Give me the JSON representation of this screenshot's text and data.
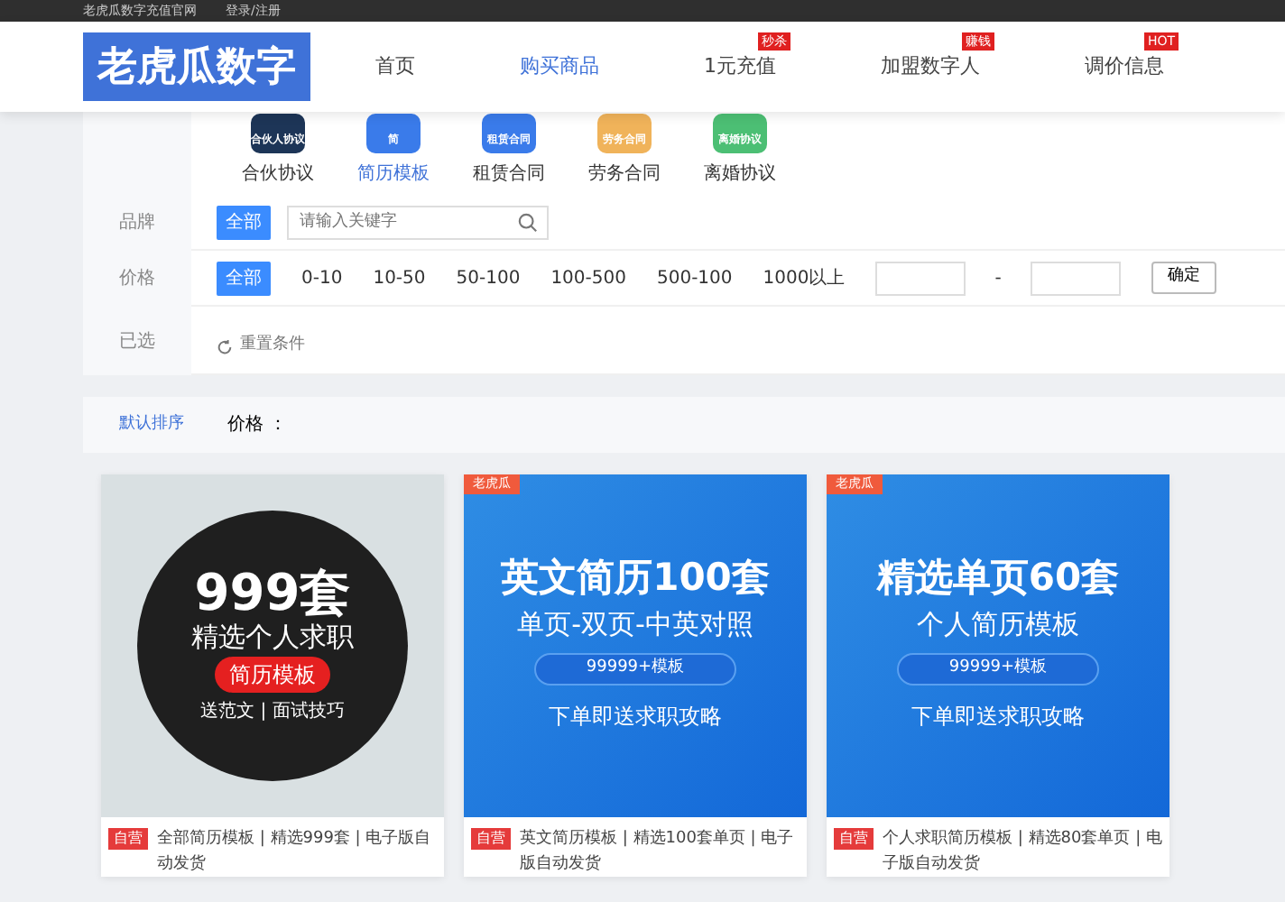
{
  "top_bar": {
    "site_link": "老虎瓜数字充值官网",
    "login_link": "登录/注册"
  },
  "logo": "老虎瓜数字",
  "nav": [
    {
      "label": "首页",
      "selected": false
    },
    {
      "label": "购买商品",
      "selected": true
    },
    {
      "label": "1元充值",
      "selected": false,
      "badge": "秒杀"
    },
    {
      "label": "加盟数字人",
      "selected": false,
      "badge": "赚钱"
    },
    {
      "label": "调价信息",
      "selected": false,
      "badge": "HOT"
    }
  ],
  "categories": [
    {
      "label": "合伙协议",
      "selected": false,
      "icon_text": "合伙人协议",
      "color": "#1d3557"
    },
    {
      "label": "简历模板",
      "selected": true,
      "icon_text": "简",
      "color": "#3a7bea"
    },
    {
      "label": "租赁合同",
      "selected": false,
      "icon_text": "租赁合同",
      "color": "#3a7bea"
    },
    {
      "label": "劳务合同",
      "selected": false,
      "icon_text": "劳务合同",
      "color": "#f0b35a"
    },
    {
      "label": "离婚协议",
      "selected": false,
      "icon_text": "离婚协议",
      "color": "#4cbf74"
    }
  ],
  "filters": {
    "brand": {
      "label": "品牌",
      "all": "全部",
      "placeholder": "请输入关键字"
    },
    "price": {
      "label": "价格",
      "all": "全部",
      "ranges": [
        "0-10",
        "10-50",
        "50-100",
        "100-500",
        "500-100",
        "1000以上"
      ],
      "separator": "-",
      "confirm": "确定"
    },
    "selected": {
      "label": "已选",
      "reset": "重置条件"
    }
  },
  "sort_bar": {
    "default": "默认排序",
    "price": "价格 ："
  },
  "products": [
    {
      "kind": "photo",
      "headline": "999套",
      "subline": "精选个人求职",
      "pill": "简历模板",
      "footer": "送范文 | 面试技巧",
      "tag": "自营",
      "title": "全部简历模板 | 精选999套 | 电子版自动发货"
    },
    {
      "kind": "banner",
      "corner_tag": "老虎瓜",
      "headline": "英文简历100套",
      "subline": "单页-双页-中英对照",
      "pill": "99999+模板",
      "footer": "下单即送求职攻略",
      "tag": "自营",
      "title": "英文简历模板 | 精选100套单页 | 电子版自动发货"
    },
    {
      "kind": "banner",
      "corner_tag": "老虎瓜",
      "headline": "精选单页60套",
      "subline": "个人简历模板",
      "pill": "99999+模板",
      "footer": "下单即送求职攻略",
      "tag": "自营",
      "title": "个人求职简历模板 | 精选80套单页 | 电子版自动发货"
    }
  ]
}
